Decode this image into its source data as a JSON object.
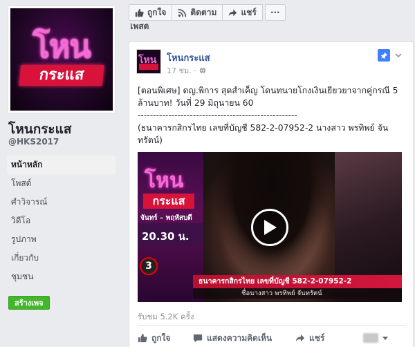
{
  "page": {
    "name": "โหนกระแส",
    "handle": "@HKS2017",
    "logo_top": "โหน",
    "logo_bottom": "กระแส"
  },
  "sidebar": {
    "items": [
      {
        "label": "หน้าหลัก",
        "active": true
      },
      {
        "label": "โพสต์"
      },
      {
        "label": "ศำวิจารณ์"
      },
      {
        "label": "วิดีโอ"
      },
      {
        "label": "รูปภาพ"
      },
      {
        "label": "เกี่ยวกับ"
      },
      {
        "label": "ชุมชน"
      }
    ],
    "create_button": "สร้างเพจ"
  },
  "action_bar": {
    "like": "ถูกใจ",
    "follow": "ติดตาม",
    "share": "แชร์",
    "more": "···"
  },
  "section_label": "โพสต์",
  "post": {
    "author": "โหนกระแส",
    "time": "17 ชม. ·",
    "text_line1": "[ตอนพิเศษ] ดญ.พิการ สุดสำเค็ญ โดนทนายโกงเงินเยียวยาจากคู่กรณี 5 ล้านบาท! วันที่ 29 มิถุนายน 60",
    "text_line2": "----------------------------------------------------",
    "text_line3": "(ธนาคารกสิกรไทย เลขที่บัญชี 582-2-07952-2 นางสาว พรทิพย์ จันทรัตน์)",
    "video": {
      "logo_top": "โหน",
      "logo_bottom": "กระแส",
      "days": "จันทร์ – พฤหัสบดี",
      "time": "20.30 น.",
      "channel": "3",
      "banner": "ธนาคารกสิกรไทย เลขที่บัญชี 582-2-07952-2",
      "sub": "ชื่อนางสาว พรทิพย์ จันทรัตน์"
    },
    "views": "รับชม 5.2K ครั้ง",
    "actions": {
      "like": "ถูกใจ",
      "comment": "แสดงความคิดเห็น",
      "share": "แชร์"
    }
  },
  "colors": {
    "link_blue": "#365899",
    "pin_blue": "#4080ff",
    "create_green": "#42b72a",
    "brand_pink": "#f26bd6",
    "brand_red": "#d8123a"
  }
}
